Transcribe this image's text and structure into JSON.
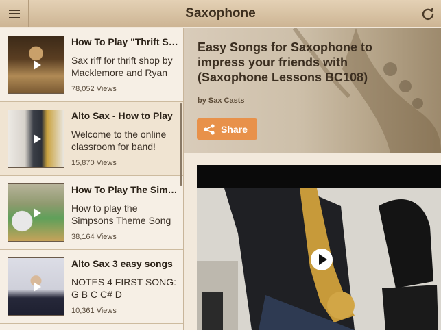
{
  "app": {
    "title": "Saxophone",
    "menu_icon": "hamburger-menu-icon",
    "refresh_icon": "refresh-icon"
  },
  "colors": {
    "topbar": "#d6c2a4",
    "accent": "#e8914a",
    "background": "#f1e7d9"
  },
  "videos": [
    {
      "title": "How To Play \"Thrift Shop\"",
      "description": "Sax riff for thrift shop by Macklemore and Ryan",
      "views": "78,052 Views"
    },
    {
      "title": "Alto Sax - How to Play",
      "description": "Welcome to the online classroom for band!",
      "views": "15,870 Views"
    },
    {
      "title": "How To Play The Simpsons",
      "description": "How to play the Simpsons Theme Song",
      "views": "38,164 Views"
    },
    {
      "title": "Alto Sax 3 easy songs",
      "description": "NOTES 4 FIRST SONG: G B C C# D",
      "views": "10,361 Views"
    }
  ],
  "detail": {
    "title": "Easy Songs for Saxophone to impress your friends with (Saxophone Lessons BC108)",
    "author": "by Sax Casts",
    "share_label": "Share"
  }
}
